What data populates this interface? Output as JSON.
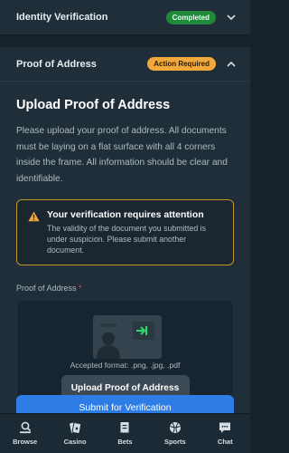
{
  "identity": {
    "title": "Identity Verification",
    "badge": "Completed"
  },
  "address": {
    "title": "Proof of Address",
    "badge": "Action Required"
  },
  "content": {
    "title": "Upload Proof of Address",
    "description": "Please upload your proof of address. All documents must be laying on a flat surface with all 4 corners inside the frame. All information should be clear and identifiable.",
    "alert_title": "Your verification requires attention",
    "alert_body": "The validity of the document you submitted is under suspicion. Please submit another document.",
    "field_label": "Proof of Address",
    "required_mark": "*",
    "accepted": "Accepted format: .png, .jpg, .pdf",
    "upload_button": "Upload Proof of Address",
    "submit_button": "Submit for Verification"
  },
  "nav": [
    {
      "label": "Browse",
      "icon": "browse-icon"
    },
    {
      "label": "Casino",
      "icon": "casino-icon"
    },
    {
      "label": "Bets",
      "icon": "bets-icon"
    },
    {
      "label": "Sports",
      "icon": "sports-icon"
    },
    {
      "label": "Chat",
      "icon": "chat-icon"
    }
  ],
  "colors": {
    "completed": "#1f8a3a",
    "action_required": "#f2a93b",
    "accent": "#2e7de6",
    "alert_border": "#c29728",
    "upload_arrow": "#2bd96b"
  }
}
